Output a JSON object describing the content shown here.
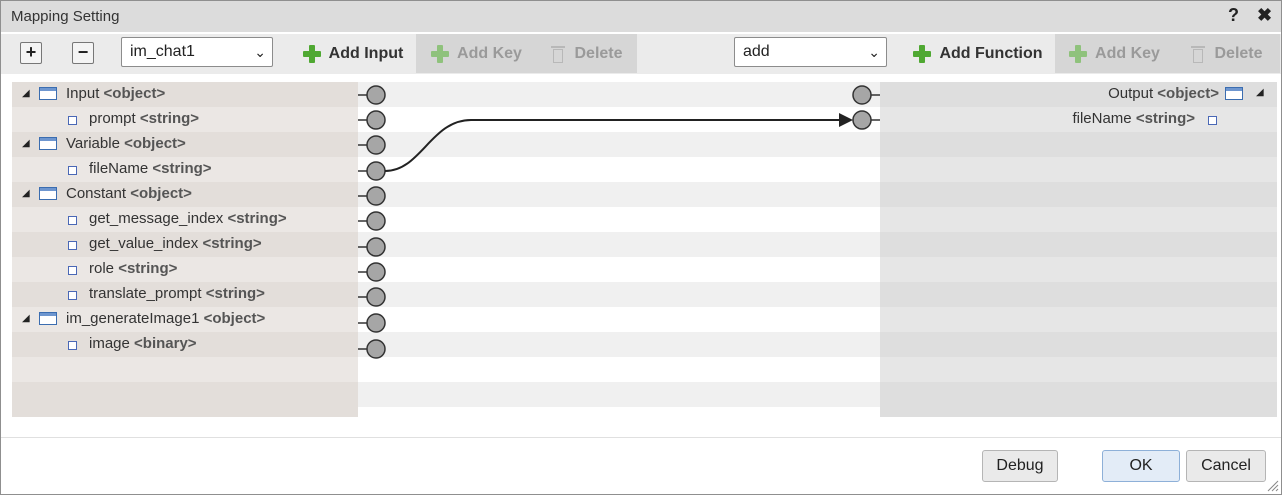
{
  "window": {
    "title": "Mapping Setting",
    "help_label": "?",
    "close_label": "✖"
  },
  "toolbar": {
    "expand_label": "+",
    "collapse_label": "−",
    "source_select": "im_chat1",
    "add_input": "Add Input",
    "add_key_left": "Add Key",
    "delete_left": "Delete",
    "function_select": "add",
    "add_function": "Add Function",
    "add_key_right": "Add Key",
    "delete_right": "Delete"
  },
  "input_tree": [
    {
      "label": "Input",
      "type": "<object>",
      "kind": "object"
    },
    {
      "label": "prompt",
      "type": "<string>",
      "kind": "leaf"
    },
    {
      "label": "Variable",
      "type": "<object>",
      "kind": "object"
    },
    {
      "label": "fileName",
      "type": "<string>",
      "kind": "leaf"
    },
    {
      "label": "Constant",
      "type": "<object>",
      "kind": "object"
    },
    {
      "label": "get_message_index",
      "type": "<string>",
      "kind": "leaf"
    },
    {
      "label": "get_value_index",
      "type": "<string>",
      "kind": "leaf"
    },
    {
      "label": "role",
      "type": "<string>",
      "kind": "leaf"
    },
    {
      "label": "translate_prompt",
      "type": "<string>",
      "kind": "leaf"
    },
    {
      "label": "im_generateImage1",
      "type": "<object>",
      "kind": "object"
    },
    {
      "label": "image",
      "type": "<binary>",
      "kind": "leaf"
    }
  ],
  "output_tree": [
    {
      "label": "Output",
      "type": "<object>",
      "kind": "object"
    },
    {
      "label": "fileName",
      "type": "<string>",
      "kind": "leaf"
    }
  ],
  "mapping": {
    "from": "Variable.fileName",
    "to": "Output.fileName"
  },
  "footer": {
    "debug": "Debug",
    "ok": "OK",
    "cancel": "Cancel"
  }
}
